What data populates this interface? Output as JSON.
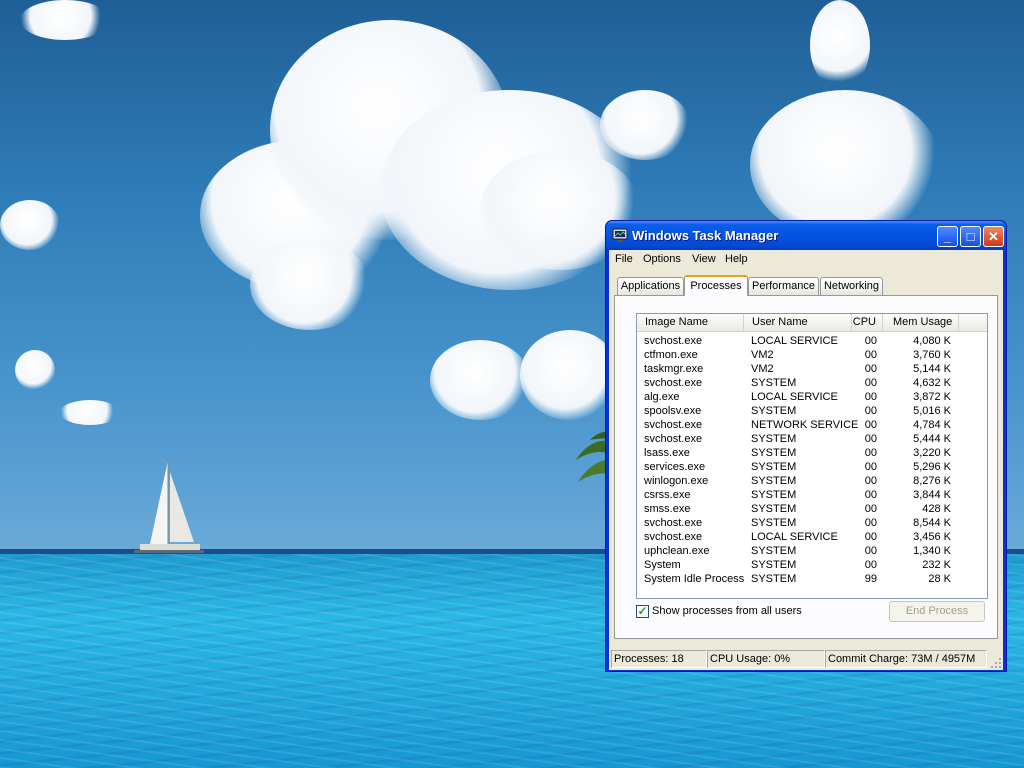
{
  "window": {
    "title": "Windows Task Manager",
    "minimize_glyph": "_",
    "maximize_glyph": "□",
    "close_glyph": "✕"
  },
  "menu": [
    "File",
    "Options",
    "View",
    "Help"
  ],
  "tabs": [
    {
      "label": "Applications",
      "active": false
    },
    {
      "label": "Processes",
      "active": true
    },
    {
      "label": "Performance",
      "active": false
    },
    {
      "label": "Networking",
      "active": false
    }
  ],
  "process_table": {
    "columns": [
      "Image Name",
      "User Name",
      "CPU",
      "Mem Usage"
    ],
    "rows": [
      [
        "svchost.exe",
        "LOCAL SERVICE",
        "00",
        "4,080 K"
      ],
      [
        "ctfmon.exe",
        "VM2",
        "00",
        "3,760 K"
      ],
      [
        "taskmgr.exe",
        "VM2",
        "00",
        "5,144 K"
      ],
      [
        "svchost.exe",
        "SYSTEM",
        "00",
        "4,632 K"
      ],
      [
        "alg.exe",
        "LOCAL SERVICE",
        "00",
        "3,872 K"
      ],
      [
        "spoolsv.exe",
        "SYSTEM",
        "00",
        "5,016 K"
      ],
      [
        "svchost.exe",
        "NETWORK SERVICE",
        "00",
        "4,784 K"
      ],
      [
        "svchost.exe",
        "SYSTEM",
        "00",
        "5,444 K"
      ],
      [
        "lsass.exe",
        "SYSTEM",
        "00",
        "3,220 K"
      ],
      [
        "services.exe",
        "SYSTEM",
        "00",
        "5,296 K"
      ],
      [
        "winlogon.exe",
        "SYSTEM",
        "00",
        "8,276 K"
      ],
      [
        "csrss.exe",
        "SYSTEM",
        "00",
        "3,844 K"
      ],
      [
        "smss.exe",
        "SYSTEM",
        "00",
        "428 K"
      ],
      [
        "svchost.exe",
        "SYSTEM",
        "00",
        "8,544 K"
      ],
      [
        "svchost.exe",
        "LOCAL SERVICE",
        "00",
        "3,456 K"
      ],
      [
        "uphclean.exe",
        "SYSTEM",
        "00",
        "1,340 K"
      ],
      [
        "System",
        "SYSTEM",
        "00",
        "232 K"
      ],
      [
        "System Idle Process",
        "SYSTEM",
        "99",
        "28 K"
      ]
    ]
  },
  "show_all_processes": {
    "label": "Show processes from all users",
    "checked": true
  },
  "end_process_label": "End Process",
  "status": {
    "processes": "Processes: 18",
    "cpu_usage": "CPU Usage: 0%",
    "commit_charge": "Commit Charge: 73M / 4957M"
  },
  "colors": {
    "titlebar": "#0554e3",
    "window_face": "#ece9d8",
    "active_tab_accent": "#e6a218",
    "checkmark": "#21a121"
  },
  "icons": {
    "title": "task-manager-icon",
    "checkbox": "checkmark-icon",
    "grip": "resize-grip-icon"
  }
}
